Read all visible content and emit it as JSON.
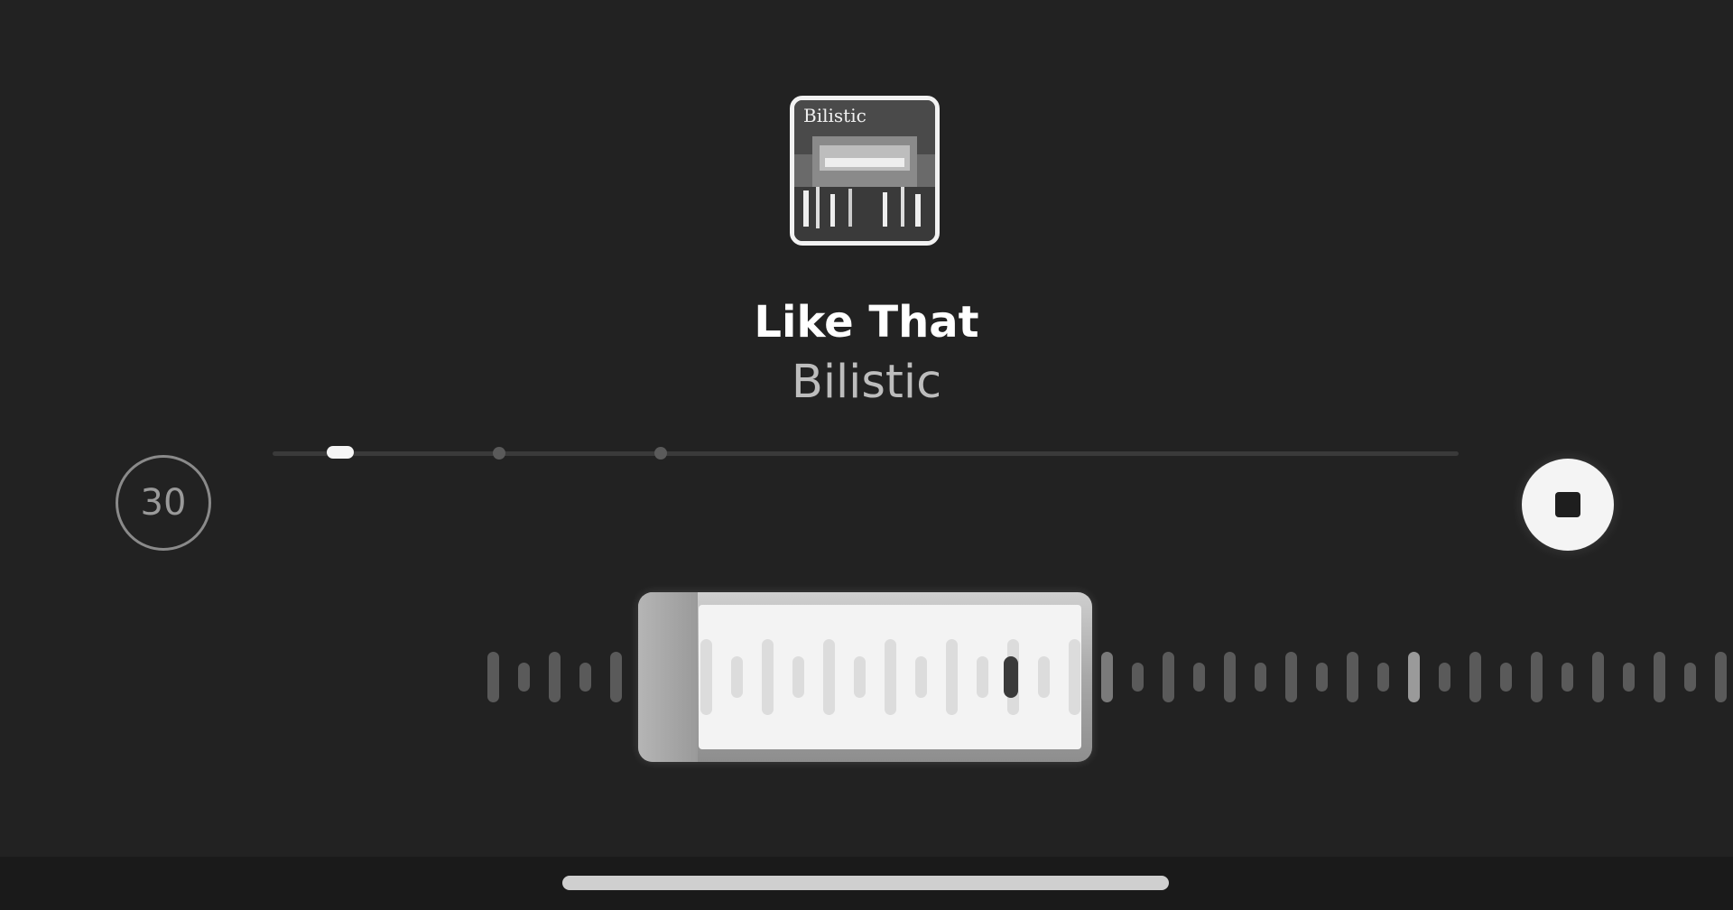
{
  "now_playing": {
    "title": "Like That",
    "artist": "Bilistic",
    "album_art_text": "Bilistic"
  },
  "controls": {
    "skip_label": "30",
    "stop_icon": "stop-icon"
  },
  "progress": {
    "playhead_fraction": 0.057,
    "marker_fractions": [
      0.191,
      0.327
    ]
  },
  "colors": {
    "background": "#222222",
    "title": "#ffffff",
    "artist": "#bdbdbd",
    "accent": "#f4f4f4"
  }
}
